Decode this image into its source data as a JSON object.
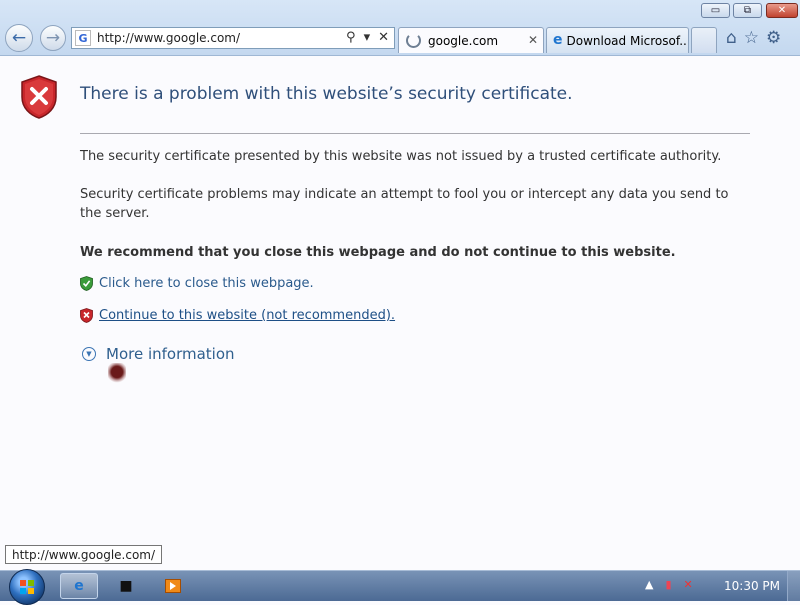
{
  "window": {
    "minimize_symbol": "▭",
    "maximize_symbol": "⧉",
    "close_symbol": "✕"
  },
  "nav": {
    "back_symbol": "←",
    "forward_symbol": "→"
  },
  "address_bar": {
    "favicon_letter": "G",
    "url": "http://www.google.com/",
    "search_symbol": "⚲",
    "dropdown_symbol": "▾",
    "stop_symbol": "✕"
  },
  "tabs": [
    {
      "label": "google.com",
      "active": true,
      "close_symbol": "✕"
    },
    {
      "label": "Download Microsof...",
      "active": false,
      "icon": "ie-icon"
    }
  ],
  "toolbar_icons": [
    "home-icon",
    "favorites-star-icon",
    "tools-gear-icon"
  ],
  "page": {
    "headline": "There is a problem with this website’s security certificate.",
    "paragraph1": "The security certificate presented by this website was not issued by a trusted certificate authority.",
    "paragraph2": "Security certificate problems may indicate an attempt to fool you or intercept any data you send to the server.",
    "recommendation": "We recommend that you close this webpage and do not continue to this website.",
    "close_link": "Click here to close this webpage.",
    "continue_link": "Continue to this website (not recommended).",
    "more_info": "More information"
  },
  "status_tooltip": "http://www.google.com/",
  "taskbar": {
    "clock": "10:30 PM",
    "tray_up_arrow": "▲"
  },
  "colors": {
    "headline": "#2f4f7a",
    "link": "#2a5a8c",
    "shield_red": "#c8262b",
    "shield_green": "#3a9b3a"
  }
}
